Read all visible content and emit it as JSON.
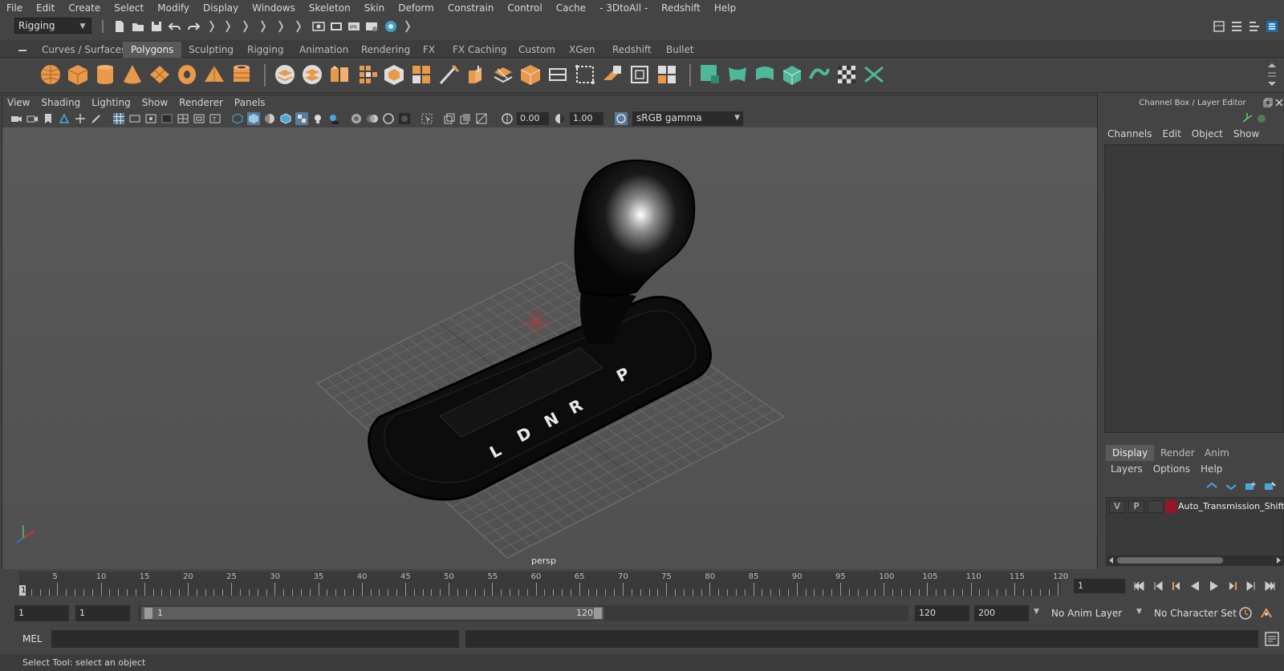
{
  "menubar": {
    "items": [
      "File",
      "Edit",
      "Create",
      "Select",
      "Modify",
      "Display",
      "Windows",
      "Skeleton",
      "Skin",
      "Deform",
      "Constrain",
      "Control",
      "Cache",
      "- 3DtoAll -",
      "Redshift",
      "Help"
    ]
  },
  "statusline": {
    "menuset": "Rigging"
  },
  "shelf": {
    "tabs": [
      "Curves / Surfaces",
      "Polygons",
      "Sculpting",
      "Rigging",
      "Animation",
      "Rendering",
      "FX",
      "FX Caching",
      "Custom",
      "XGen",
      "Redshift",
      "Bullet"
    ],
    "active_tab": "Polygons"
  },
  "viewport": {
    "menu": [
      "View",
      "Shading",
      "Lighting",
      "Show",
      "Renderer",
      "Panels"
    ],
    "exposure": "0.00",
    "gamma": "1.00",
    "color_space": "sRGB gamma",
    "camera": "persp",
    "gear_labels": [
      "P",
      "R",
      "N",
      "D",
      "L"
    ]
  },
  "right_panel": {
    "title": "Channel Box / Layer Editor",
    "channel_menu": [
      "Channels",
      "Edit",
      "Object",
      "Show"
    ],
    "layer_tabs": [
      "Display",
      "Render",
      "Anim"
    ],
    "active_layer_tab": "Display",
    "layer_menu": [
      "Layers",
      "Options",
      "Help"
    ],
    "layer": {
      "visible": "V",
      "playback": "P",
      "name": "Auto_Transmission_Shift",
      "color": "#9b1326"
    }
  },
  "timeline": {
    "ticks": [
      "1",
      "5",
      "10",
      "15",
      "20",
      "25",
      "30",
      "35",
      "40",
      "45",
      "50",
      "55",
      "60",
      "65",
      "70",
      "75",
      "80",
      "85",
      "90",
      "95",
      "100",
      "105",
      "110",
      "115",
      "120"
    ],
    "current_frame": "1",
    "current_frame_field": "1"
  },
  "range": {
    "start_field": "1",
    "anim_start_field": "1",
    "slider_start": "1",
    "slider_end": "120",
    "end_field": "120",
    "anim_end_field": "200",
    "anim_layer": "No Anim Layer",
    "character_set": "No Character Set"
  },
  "commandline": {
    "label": "MEL"
  },
  "helpline": {
    "text": "Select Tool: select an object"
  }
}
